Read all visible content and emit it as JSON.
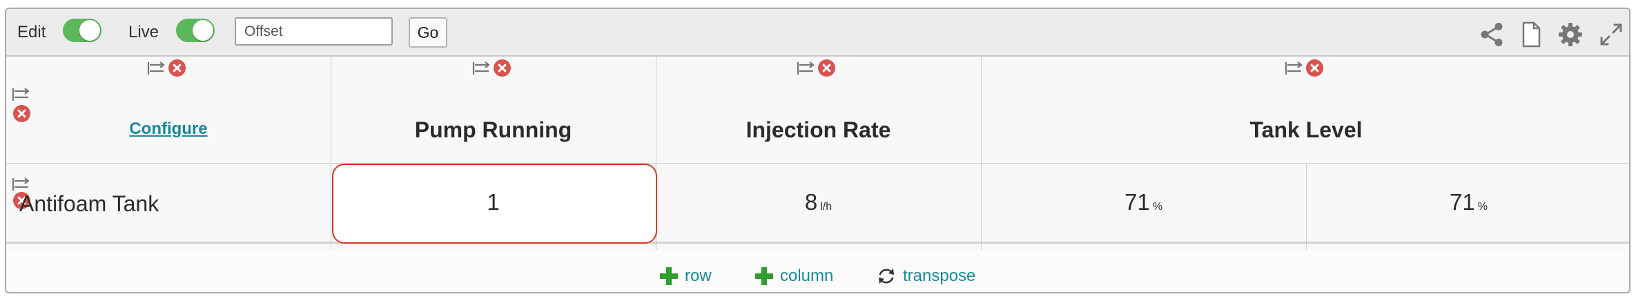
{
  "toolbar": {
    "edit_label": "Edit",
    "live_label": "Live",
    "edit_on": true,
    "live_on": true,
    "offset_placeholder": "Offset",
    "go_label": "Go",
    "icons": [
      "share-icon",
      "document-icon",
      "gear-icon",
      "expand-icon"
    ]
  },
  "table": {
    "configure_label": "Configure",
    "columns": [
      {
        "header": "Pump Running"
      },
      {
        "header": "Injection Rate"
      },
      {
        "header": "Tank Level"
      }
    ],
    "rows": [
      {
        "label": "Antifoam Tank",
        "cells": [
          {
            "value": "1",
            "unit": ""
          },
          {
            "value": "8",
            "unit": "l/h"
          },
          {
            "value": "71",
            "unit": "%"
          },
          {
            "value": "71",
            "unit": "%"
          }
        ]
      }
    ]
  },
  "actions": {
    "row_label": "row",
    "column_label": "column",
    "transpose_label": "transpose"
  },
  "colors": {
    "accent_link": "#17899b",
    "toggle_on": "#5cb85c",
    "remove": "#d9534f",
    "add": "#2f9e2f",
    "selection_border": "#d9361f"
  }
}
